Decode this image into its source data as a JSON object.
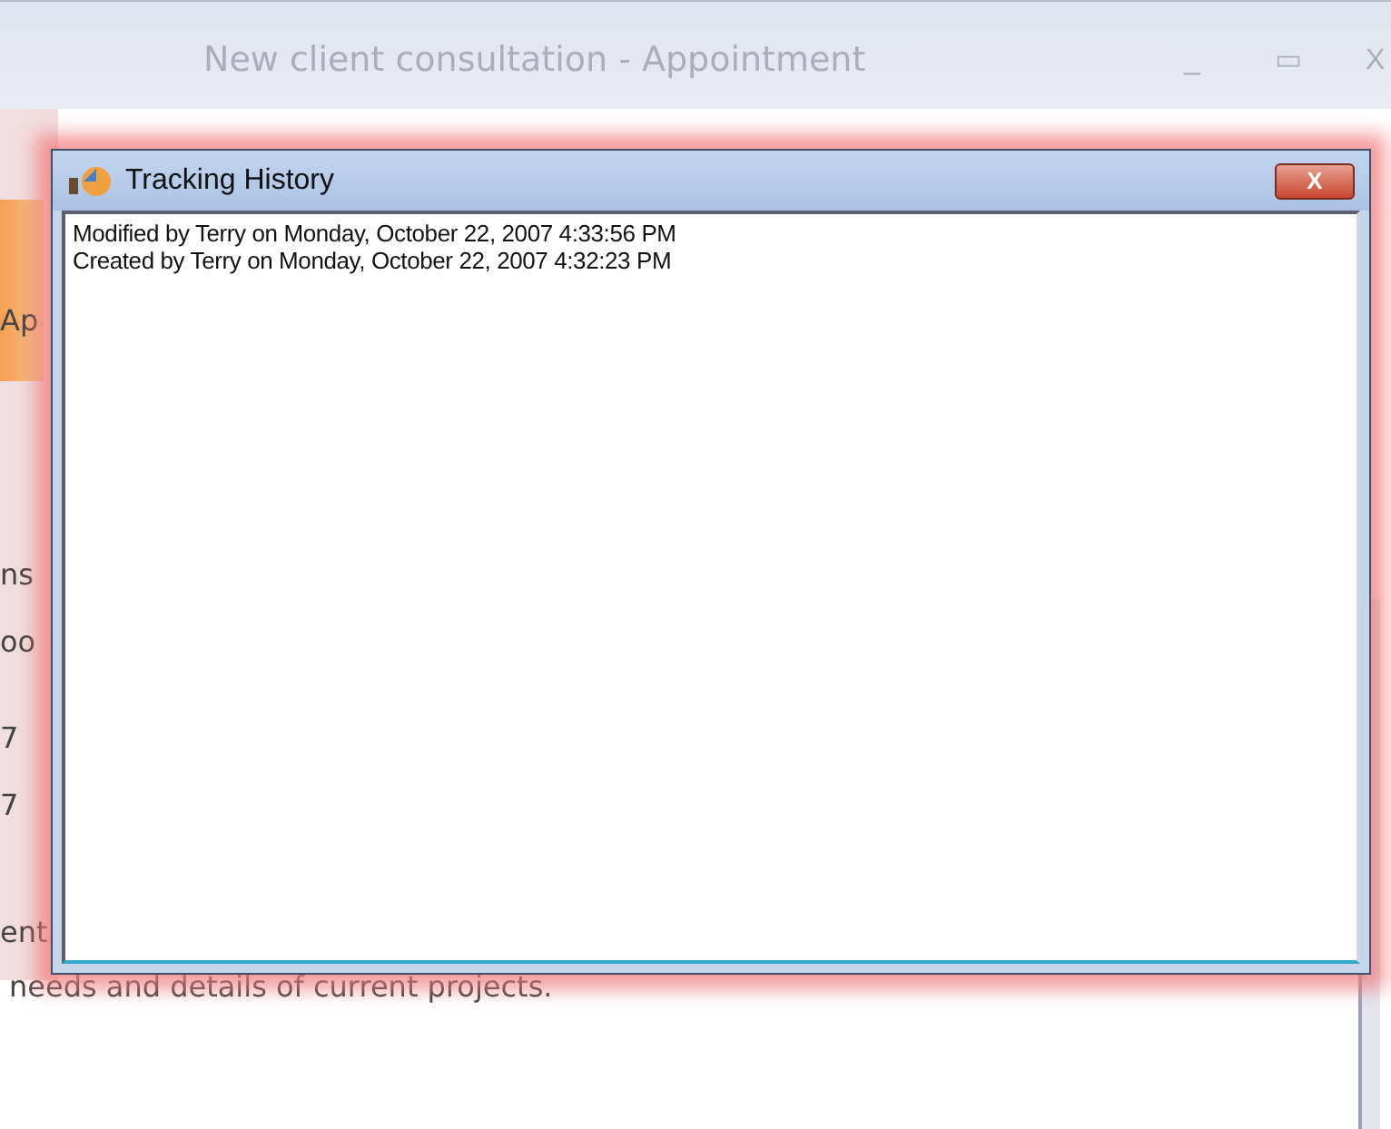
{
  "window": {
    "title": "New client consultation - Appointment",
    "controls": [
      "_",
      "▭",
      "X"
    ]
  },
  "background_fragments": [
    "Ap",
    "ns",
    "oo",
    "7",
    "7",
    "ent"
  ],
  "background_note": "needs and details of current projects.",
  "dialog": {
    "title": "Tracking History",
    "close": "X",
    "entries": [
      "Modified by Terry on Monday, October 22, 2007 4:33:56 PM",
      "Created by Terry on Monday, October 22, 2007 4:32:23 PM"
    ]
  }
}
